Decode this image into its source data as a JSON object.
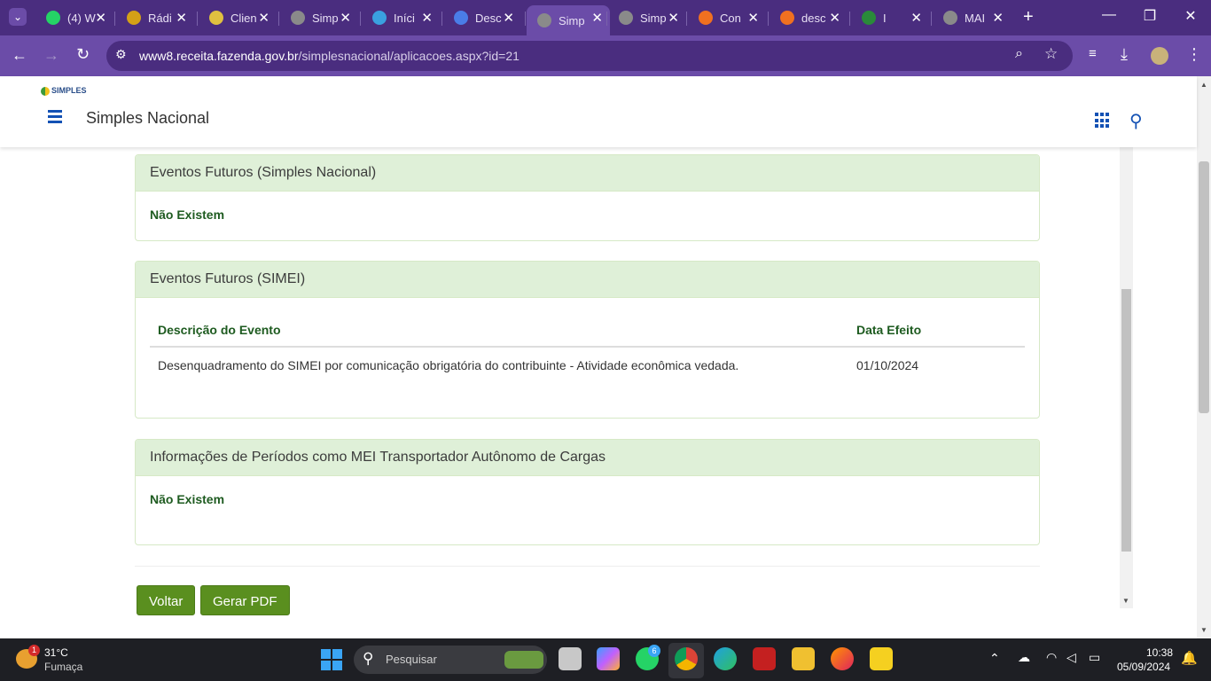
{
  "browser": {
    "tabs": [
      {
        "label": "(4) W",
        "color": "#25d366"
      },
      {
        "label": "Rádi",
        "color": "#d4a017"
      },
      {
        "label": "Clien",
        "color": "#e0c040"
      },
      {
        "label": "Simp",
        "color": "#8a8a8a"
      },
      {
        "label": "Iníci",
        "color": "#3aa0e0"
      },
      {
        "label": "Desc",
        "color": "#4a7de8"
      },
      {
        "label": "Simp",
        "color": "#8a8a8a"
      },
      {
        "label": "Simp",
        "color": "#8a8a8a"
      },
      {
        "label": "Con",
        "color": "#f07020"
      },
      {
        "label": "desc",
        "color": "#f07020"
      },
      {
        "label": "I",
        "color": "#2a8a3a"
      },
      {
        "label": "MAI",
        "color": "#8a8a8a"
      }
    ],
    "active_tab_index": 6,
    "url_host": "www8.receita.fazenda.gov.br",
    "url_path": "/simplesnacional/aplicacoes.aspx?id=21"
  },
  "header": {
    "logo_text": "SIMPLES",
    "title": "Simples Nacional"
  },
  "sections": {
    "simples": {
      "title": "Eventos Futuros (Simples Nacional)",
      "empty_text": "Não Existem"
    },
    "simei": {
      "title": "Eventos Futuros (SIMEI)",
      "columns": [
        "Descrição do Evento",
        "Data Efeito"
      ],
      "rows": [
        [
          "Desenquadramento do SIMEI por comunicação obrigatória do contribuinte - Atividade econômica vedada.",
          "01/10/2024"
        ]
      ]
    },
    "mei_transportador": {
      "title": "Informações de Períodos como MEI Transportador Autônomo de Cargas",
      "empty_text": "Não Existem"
    }
  },
  "actions": {
    "back_label": "Voltar",
    "pdf_label": "Gerar PDF"
  },
  "taskbar": {
    "weather_temp": "31°C",
    "weather_desc": "Fumaça",
    "weather_badge": "1",
    "search_placeholder": "Pesquisar",
    "whatsapp_badge": "6",
    "time": "10:38",
    "date": "05/09/2024"
  }
}
